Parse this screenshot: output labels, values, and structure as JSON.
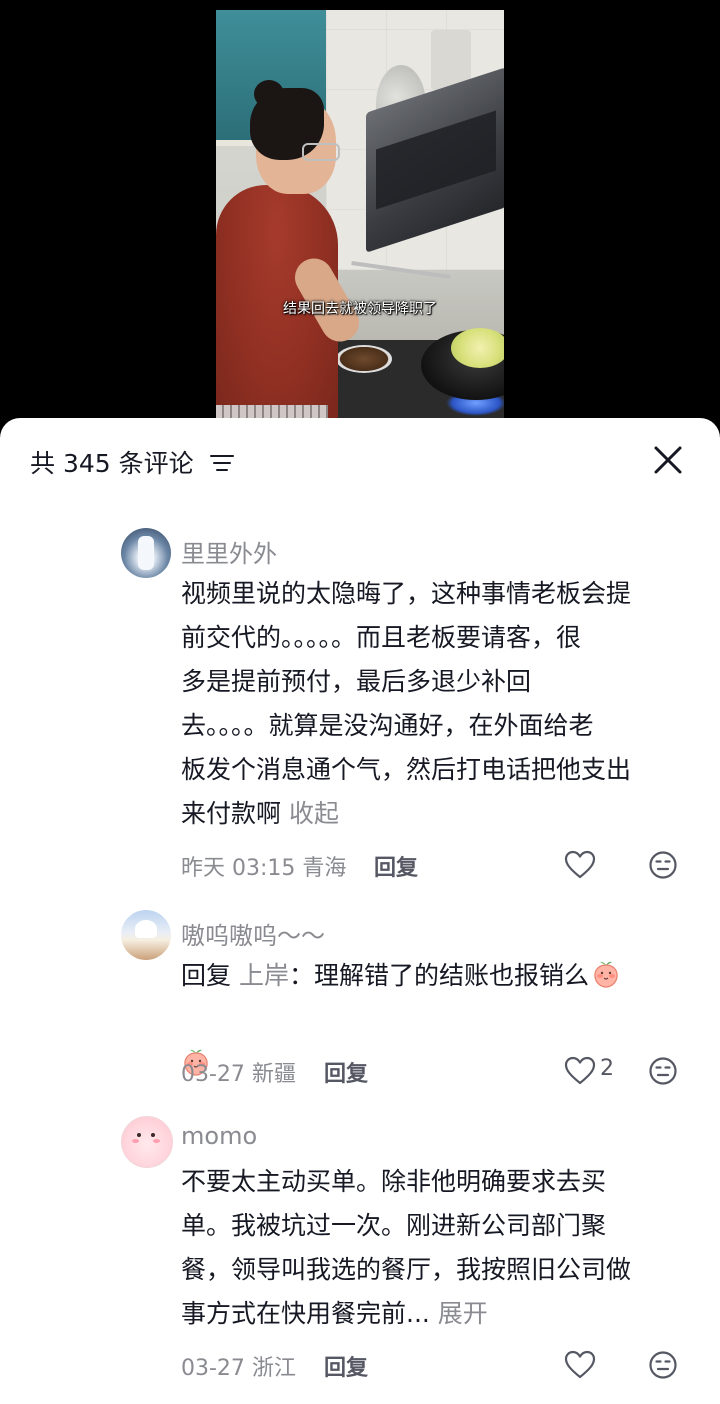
{
  "video": {
    "subtitle": "结果回去就被领导降职了"
  },
  "comments_header": {
    "title": "共 345 条评论",
    "filter_icon": "filter-icon",
    "close_icon": "close-icon"
  },
  "comments": [
    {
      "nickname": "里里外外",
      "content": "视频里说的太隐晦了，这种事情老板会提\n前交代的。。。。。而且老板要请客，很\n多是提前预付，最后多退少补回\n去。。。。就算是没沟通好，在外面给老\n板发个消息通个气，然后打电话把他支出\n来付款啊",
      "collapse_label": "收起",
      "time": "昨天 03:15",
      "location": "青海",
      "reply_label": "回复",
      "likes": ""
    },
    {
      "nickname": "嗷呜嗷呜～～",
      "reply_prefix": "回复",
      "reply_to": "上岸",
      "content": "：理解错了的结账也报销么",
      "emoji": "peach-emoji",
      "time": "03-27",
      "location": "新疆",
      "reply_label": "回复",
      "likes": "2"
    },
    {
      "nickname": "momo",
      "content": "不要太主动买单。除非他明确要求去买\n单。我被坑过一次。刚进新公司部门聚\n餐，领导叫我选的餐厅，我按照旧公司做\n事方式在快用餐完前...",
      "expand_label": "展开",
      "time": "03-27",
      "location": "浙江",
      "reply_label": "回复",
      "likes": ""
    }
  ],
  "colors": {
    "background": "#000000",
    "sheet": "#ffffff",
    "text_primary": "#161823",
    "text_secondary": "#8a8b91"
  }
}
